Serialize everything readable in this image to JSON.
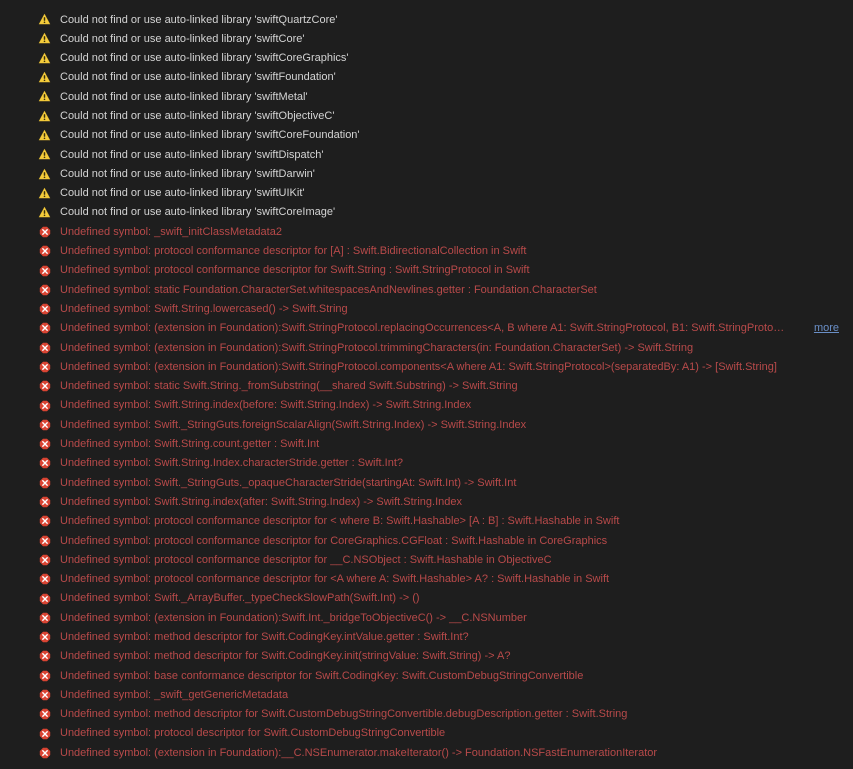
{
  "more_label": "more",
  "issues": [
    {
      "type": "warning",
      "text": "Could not find or use auto-linked library 'swiftQuartzCore'"
    },
    {
      "type": "warning",
      "text": "Could not find or use auto-linked library 'swiftCore'"
    },
    {
      "type": "warning",
      "text": "Could not find or use auto-linked library 'swiftCoreGraphics'"
    },
    {
      "type": "warning",
      "text": "Could not find or use auto-linked library 'swiftFoundation'"
    },
    {
      "type": "warning",
      "text": "Could not find or use auto-linked library 'swiftMetal'"
    },
    {
      "type": "warning",
      "text": "Could not find or use auto-linked library 'swiftObjectiveC'"
    },
    {
      "type": "warning",
      "text": "Could not find or use auto-linked library 'swiftCoreFoundation'"
    },
    {
      "type": "warning",
      "text": "Could not find or use auto-linked library 'swiftDispatch'"
    },
    {
      "type": "warning",
      "text": "Could not find or use auto-linked library 'swiftDarwin'"
    },
    {
      "type": "warning",
      "text": "Could not find or use auto-linked library 'swiftUIKit'"
    },
    {
      "type": "warning",
      "text": "Could not find or use auto-linked library 'swiftCoreImage'"
    },
    {
      "type": "error",
      "text": "Undefined symbol: _swift_initClassMetadata2"
    },
    {
      "type": "error",
      "text": "Undefined symbol: protocol conformance descriptor for [A] : Swift.BidirectionalCollection in Swift"
    },
    {
      "type": "error",
      "text": "Undefined symbol: protocol conformance descriptor for Swift.String : Swift.StringProtocol in Swift"
    },
    {
      "type": "error",
      "text": "Undefined symbol: static Foundation.CharacterSet.whitespacesAndNewlines.getter : Foundation.CharacterSet"
    },
    {
      "type": "error",
      "text": "Undefined symbol: Swift.String.lowercased() -> Swift.String"
    },
    {
      "type": "error",
      "text": "Undefined symbol: (extension in Foundation):Swift.StringProtocol.replacingOccurrences<A, B where A1: Swift.StringProtocol, B1: Swift.StringProto…",
      "has_more": true
    },
    {
      "type": "error",
      "text": "Undefined symbol: (extension in Foundation):Swift.StringProtocol.trimmingCharacters(in: Foundation.CharacterSet) -> Swift.String"
    },
    {
      "type": "error",
      "text": "Undefined symbol: (extension in Foundation):Swift.StringProtocol.components<A where A1: Swift.StringProtocol>(separatedBy: A1) -> [Swift.String]"
    },
    {
      "type": "error",
      "text": "Undefined symbol: static Swift.String._fromSubstring(__shared Swift.Substring) -> Swift.String"
    },
    {
      "type": "error",
      "text": "Undefined symbol: Swift.String.index(before: Swift.String.Index) -> Swift.String.Index"
    },
    {
      "type": "error",
      "text": "Undefined symbol: Swift._StringGuts.foreignScalarAlign(Swift.String.Index) -> Swift.String.Index"
    },
    {
      "type": "error",
      "text": "Undefined symbol: Swift.String.count.getter : Swift.Int"
    },
    {
      "type": "error",
      "text": "Undefined symbol: Swift.String.Index.characterStride.getter : Swift.Int?"
    },
    {
      "type": "error",
      "text": "Undefined symbol: Swift._StringGuts._opaqueCharacterStride(startingAt: Swift.Int) -> Swift.Int"
    },
    {
      "type": "error",
      "text": "Undefined symbol: Swift.String.index(after: Swift.String.Index) -> Swift.String.Index"
    },
    {
      "type": "error",
      "text": "Undefined symbol: protocol conformance descriptor for < where B: Swift.Hashable> [A : B] : Swift.Hashable in Swift"
    },
    {
      "type": "error",
      "text": "Undefined symbol: protocol conformance descriptor for CoreGraphics.CGFloat : Swift.Hashable in CoreGraphics"
    },
    {
      "type": "error",
      "text": "Undefined symbol: protocol conformance descriptor for __C.NSObject : Swift.Hashable in ObjectiveC"
    },
    {
      "type": "error",
      "text": "Undefined symbol: protocol conformance descriptor for <A where A: Swift.Hashable> A? : Swift.Hashable in Swift"
    },
    {
      "type": "error",
      "text": "Undefined symbol: Swift._ArrayBuffer._typeCheckSlowPath(Swift.Int) -> ()"
    },
    {
      "type": "error",
      "text": "Undefined symbol: (extension in Foundation):Swift.Int._bridgeToObjectiveC() -> __C.NSNumber"
    },
    {
      "type": "error",
      "text": "Undefined symbol: method descriptor for Swift.CodingKey.intValue.getter : Swift.Int?"
    },
    {
      "type": "error",
      "text": "Undefined symbol: method descriptor for Swift.CodingKey.init(stringValue: Swift.String) -> A?"
    },
    {
      "type": "error",
      "text": "Undefined symbol: base conformance descriptor for Swift.CodingKey: Swift.CustomDebugStringConvertible"
    },
    {
      "type": "error",
      "text": "Undefined symbol: _swift_getGenericMetadata"
    },
    {
      "type": "error",
      "text": "Undefined symbol: method descriptor for Swift.CustomDebugStringConvertible.debugDescription.getter : Swift.String"
    },
    {
      "type": "error",
      "text": "Undefined symbol: protocol descriptor for Swift.CustomDebugStringConvertible"
    },
    {
      "type": "error",
      "text": "Undefined symbol: (extension in Foundation):__C.NSEnumerator.makeIterator() -> Foundation.NSFastEnumerationIterator"
    }
  ]
}
